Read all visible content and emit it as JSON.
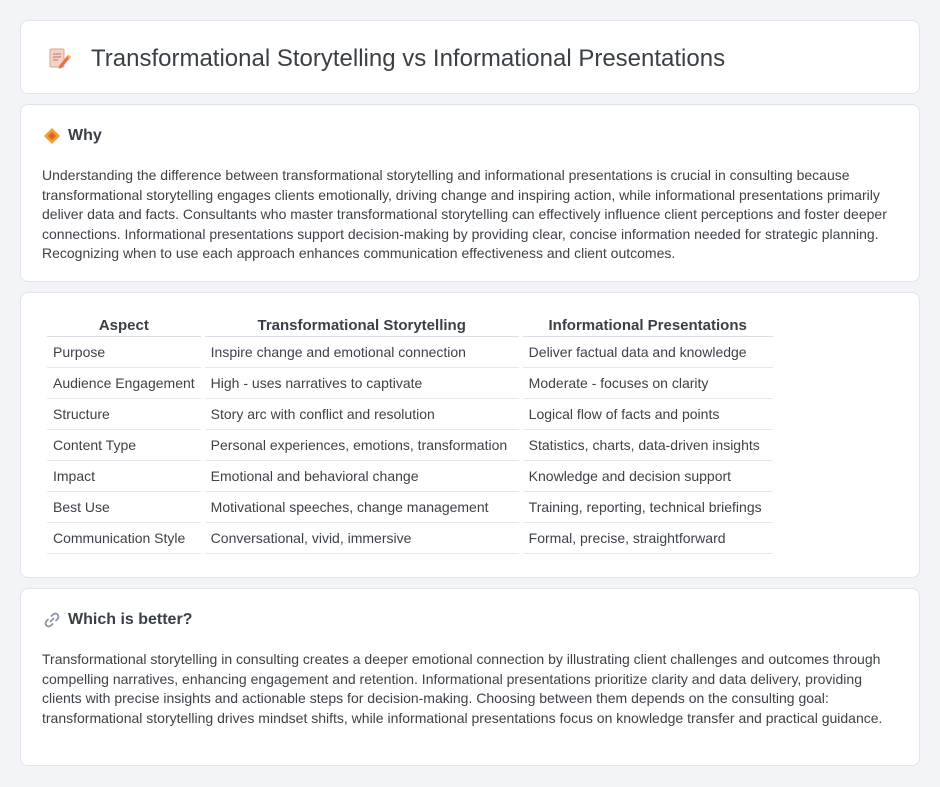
{
  "header": {
    "title": "Transformational Storytelling vs Informational Presentations",
    "icon": "pencil-document-icon"
  },
  "why": {
    "icon": "diamond-icon",
    "title": "Why",
    "text": "Understanding the difference between transformational storytelling and informational presentations is crucial in consulting because transformational storytelling engages clients emotionally, driving change and inspiring action, while informational presentations primarily deliver data and facts. Consultants who master transformational storytelling can effectively influence client perceptions and foster deeper connections. Informational presentations support decision-making by providing clear, concise information needed for strategic planning. Recognizing when to use each approach enhances communication effectiveness and client outcomes."
  },
  "comparison": {
    "headers": [
      "Aspect",
      "Transformational Storytelling",
      "Informational Presentations"
    ],
    "rows": [
      [
        "Purpose",
        "Inspire change and emotional connection",
        "Deliver factual data and knowledge"
      ],
      [
        "Audience Engagement",
        "High - uses narratives to captivate",
        "Moderate - focuses on clarity"
      ],
      [
        "Structure",
        "Story arc with conflict and resolution",
        "Logical flow of facts and points"
      ],
      [
        "Content Type",
        "Personal experiences, emotions, transformation",
        "Statistics, charts, data-driven insights"
      ],
      [
        "Impact",
        "Emotional and behavioral change",
        "Knowledge and decision support"
      ],
      [
        "Best Use",
        "Motivational speeches, change management",
        "Training, reporting, technical briefings"
      ],
      [
        "Communication Style",
        "Conversational, vivid, immersive",
        "Formal, precise, straightforward"
      ]
    ]
  },
  "better": {
    "icon": "link-icon",
    "title": "Which is better?",
    "text": "Transformational storytelling in consulting creates a deeper emotional connection by illustrating client challenges and outcomes through compelling narratives, enhancing engagement and retention. Informational presentations prioritize clarity and data delivery, providing clients with precise insights and actionable steps for decision-making. Choosing between them depends on the consulting goal: transformational storytelling drives mindset shifts, while informational presentations focus on knowledge transfer and practical guidance."
  },
  "colors": {
    "background": "#f3f4f7",
    "card": "#ffffff",
    "diamond": "#f0a030",
    "pencil": "#e8734a"
  }
}
